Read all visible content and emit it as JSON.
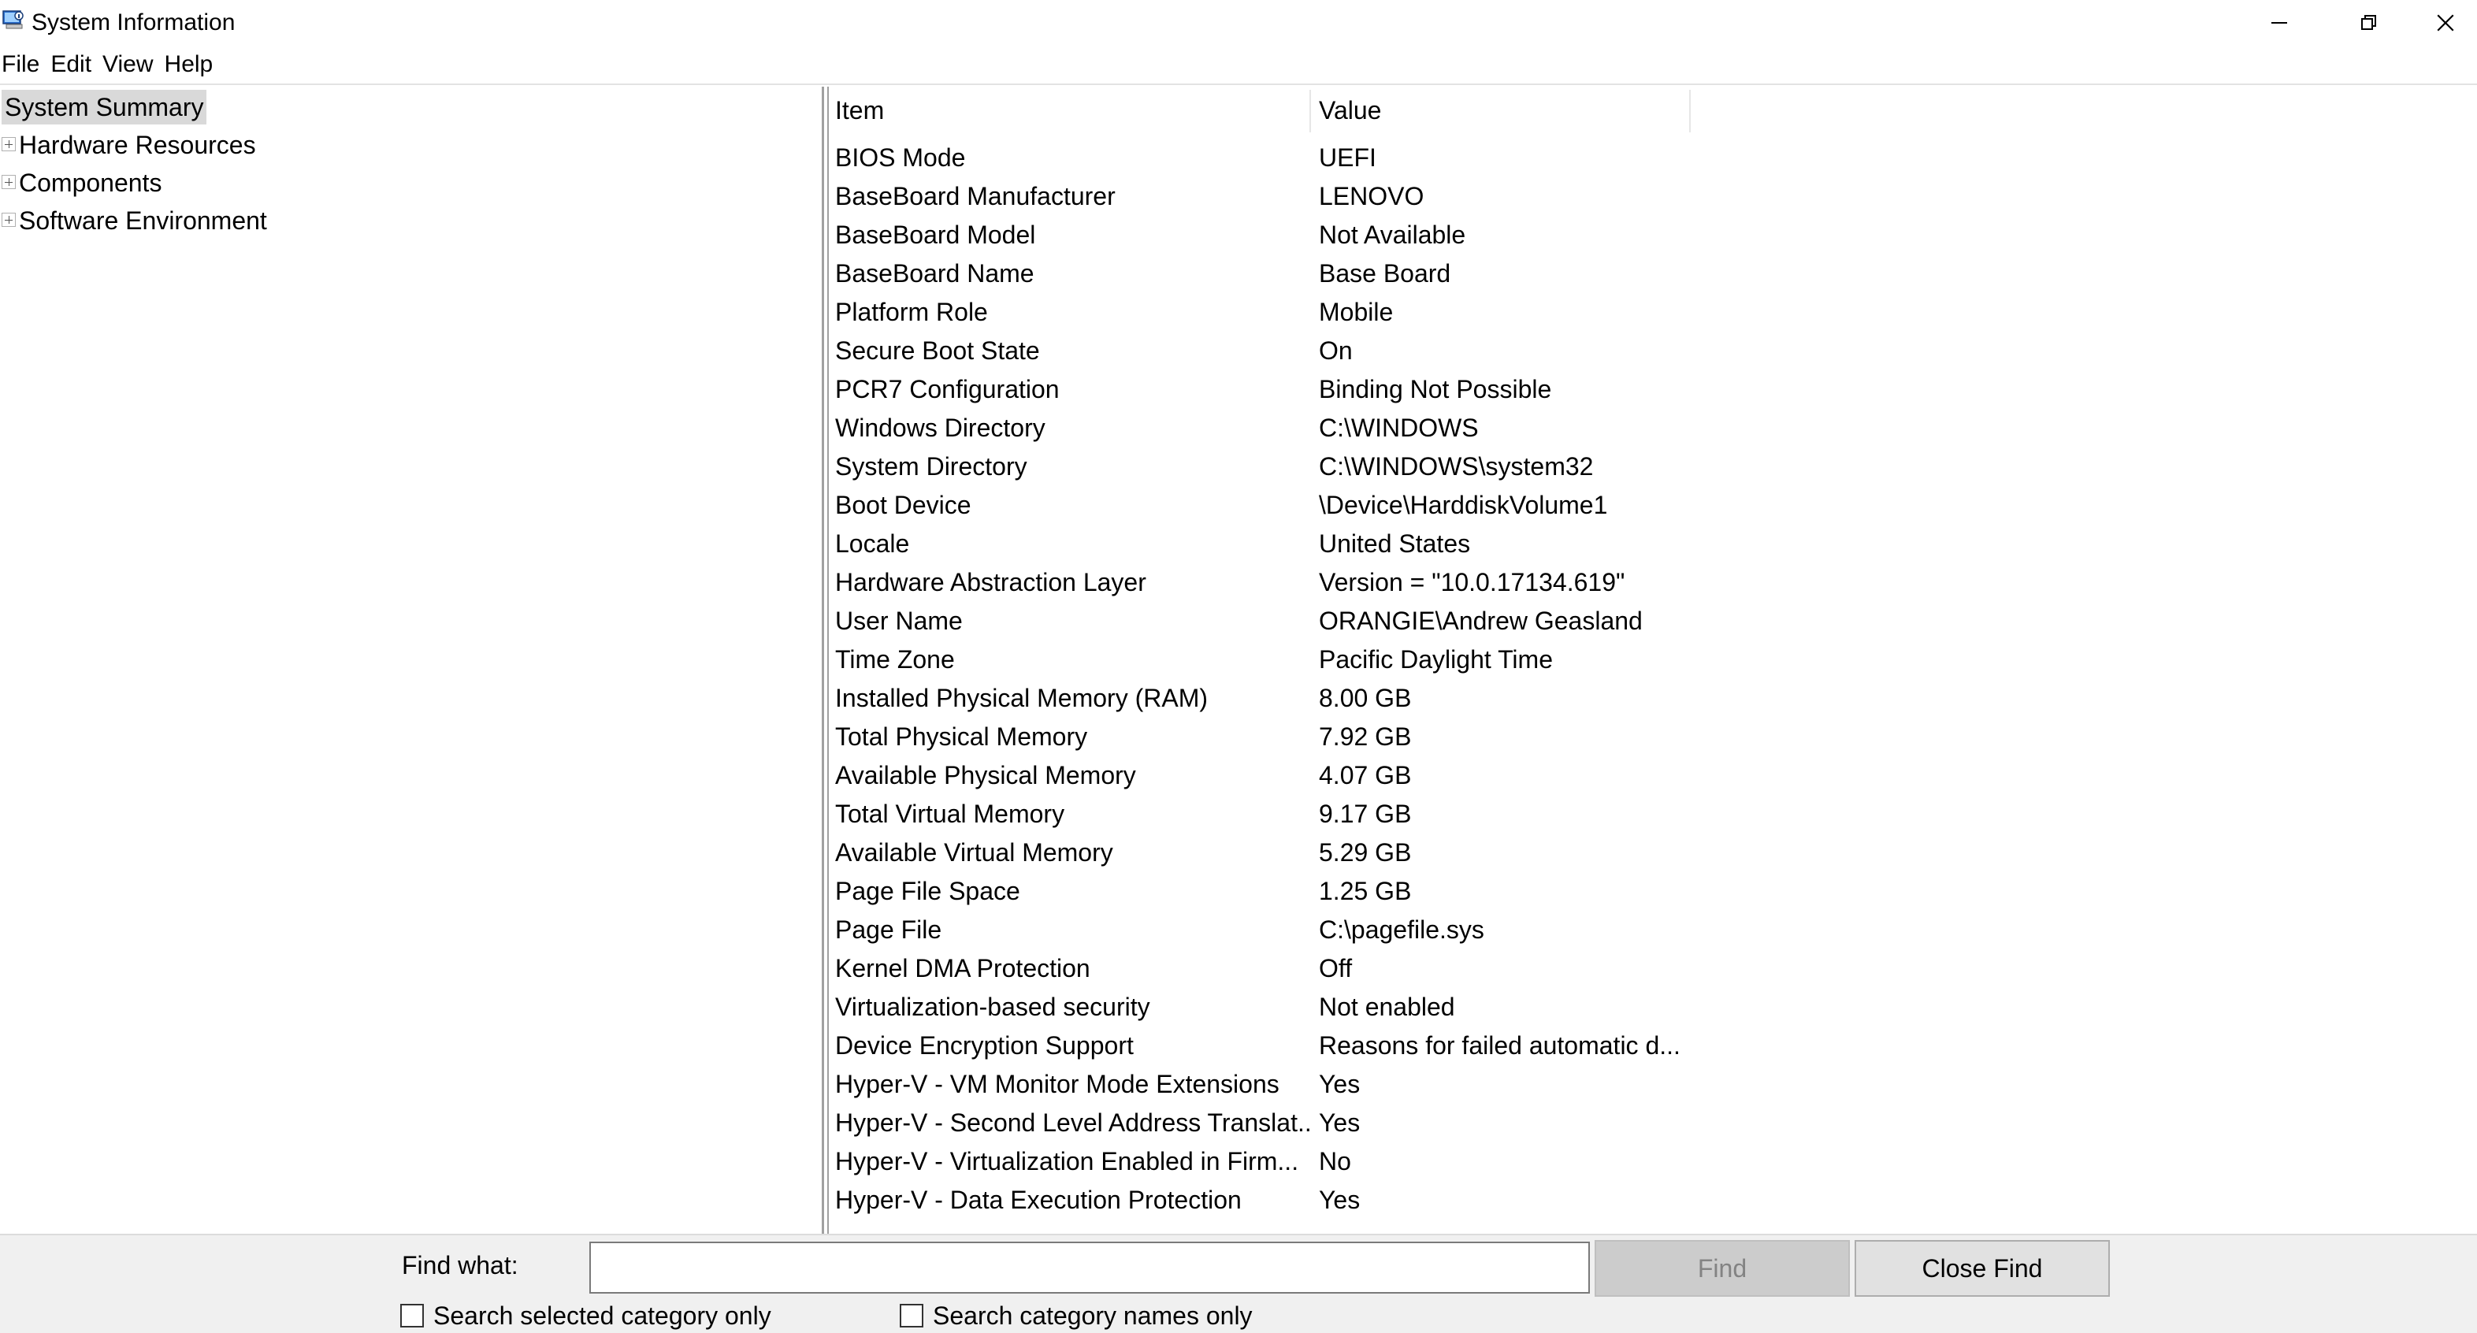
{
  "window": {
    "title": "System Information",
    "icon": "system-information-app-icon",
    "controls": [
      "minimize-icon",
      "restore-icon",
      "close-icon"
    ]
  },
  "menu": [
    "File",
    "Edit",
    "View",
    "Help"
  ],
  "tree": {
    "selected": "System Summary",
    "children": [
      "Hardware Resources",
      "Components",
      "Software Environment"
    ]
  },
  "list": {
    "columns": {
      "item": "Item",
      "value": "Value"
    },
    "rows": [
      {
        "item": "BIOS Mode",
        "value": "UEFI"
      },
      {
        "item": "BaseBoard Manufacturer",
        "value": "LENOVO"
      },
      {
        "item": "BaseBoard Model",
        "value": "Not Available"
      },
      {
        "item": "BaseBoard Name",
        "value": "Base Board"
      },
      {
        "item": "Platform Role",
        "value": "Mobile"
      },
      {
        "item": "Secure Boot State",
        "value": "On"
      },
      {
        "item": "PCR7 Configuration",
        "value": "Binding Not Possible"
      },
      {
        "item": "Windows Directory",
        "value": "C:\\WINDOWS"
      },
      {
        "item": "System Directory",
        "value": "C:\\WINDOWS\\system32"
      },
      {
        "item": "Boot Device",
        "value": "\\Device\\HarddiskVolume1"
      },
      {
        "item": "Locale",
        "value": "United States"
      },
      {
        "item": "Hardware Abstraction Layer",
        "value": "Version = \"10.0.17134.619\""
      },
      {
        "item": "User Name",
        "value": "ORANGIE\\Andrew Geasland"
      },
      {
        "item": "Time Zone",
        "value": "Pacific Daylight Time"
      },
      {
        "item": "Installed Physical Memory (RAM)",
        "value": "8.00 GB"
      },
      {
        "item": "Total Physical Memory",
        "value": "7.92 GB"
      },
      {
        "item": "Available Physical Memory",
        "value": "4.07 GB"
      },
      {
        "item": "Total Virtual Memory",
        "value": "9.17 GB"
      },
      {
        "item": "Available Virtual Memory",
        "value": "5.29 GB"
      },
      {
        "item": "Page File Space",
        "value": "1.25 GB"
      },
      {
        "item": "Page File",
        "value": "C:\\pagefile.sys"
      },
      {
        "item": "Kernel DMA Protection",
        "value": "Off"
      },
      {
        "item": "Virtualization-based security",
        "value": "Not enabled"
      },
      {
        "item": "Device Encryption Support",
        "value": "Reasons for failed automatic d..."
      },
      {
        "item": "Hyper-V - VM Monitor Mode Extensions",
        "value": "Yes"
      },
      {
        "item": "Hyper-V - Second Level Address Translat...",
        "value": "Yes"
      },
      {
        "item": "Hyper-V - Virtualization Enabled in Firm...",
        "value": "No"
      },
      {
        "item": "Hyper-V - Data Execution Protection",
        "value": "Yes"
      }
    ]
  },
  "find": {
    "label": "Find what:",
    "value": "",
    "find_button": "Find",
    "close_button": "Close Find",
    "search_selected_label": "Search selected category only",
    "search_names_label": "Search category names only",
    "search_selected_checked": false,
    "search_names_checked": false
  }
}
